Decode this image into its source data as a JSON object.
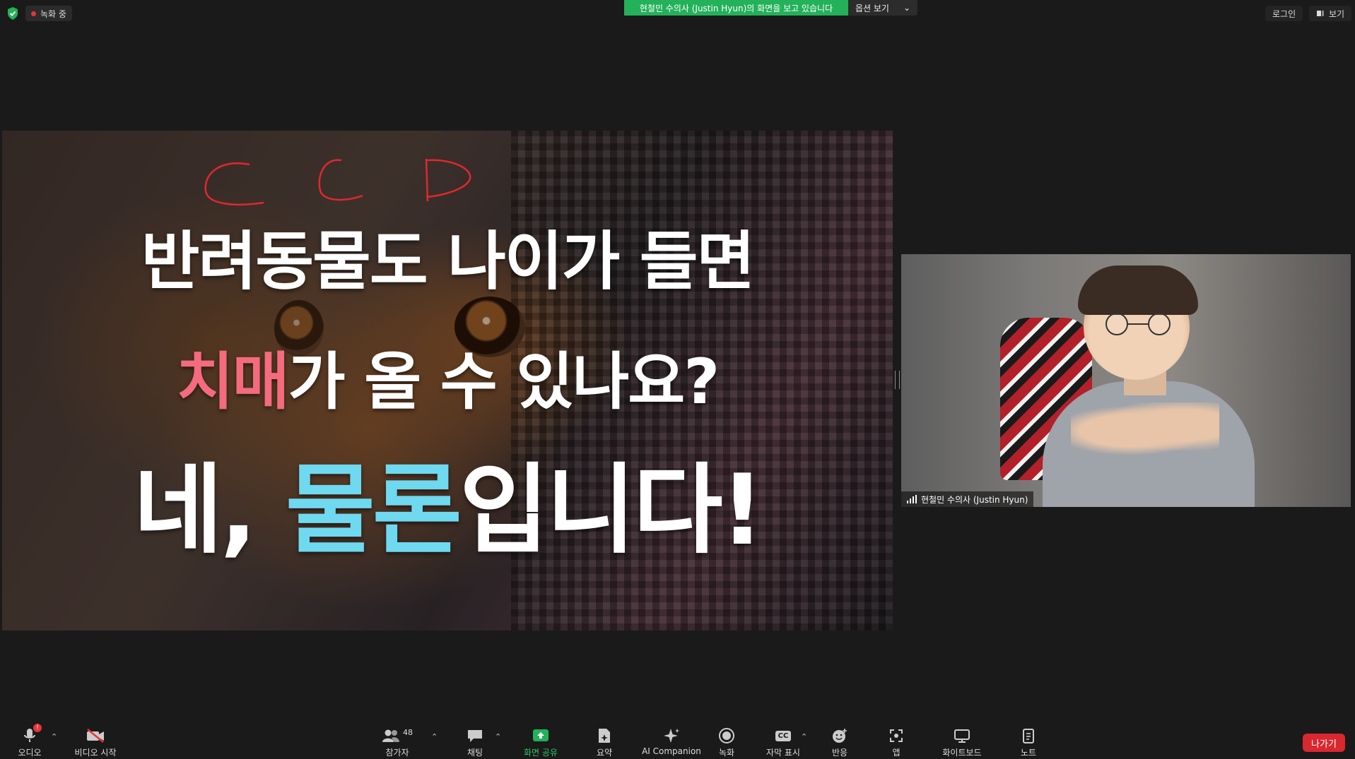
{
  "topbar": {
    "recording_label": "녹화 중",
    "share_banner": "현철민 수의사 (Justin  Hyun)의 화면을 보고 있습니다",
    "view_options": "옵션 보기",
    "login": "로그인",
    "view": "보기"
  },
  "slide": {
    "line1": "반려동물도 나이가 들면",
    "line2_highlight": "치매",
    "line2_rest": "가 올 수 있나요?",
    "line3_start": "네, ",
    "line3_highlight": "물론",
    "line3_end": "입니다!",
    "annotation_color": "#e0282e"
  },
  "video_tile": {
    "participant_name": "현철민 수의사 (Justin Hyun)"
  },
  "toolbar": {
    "audio": "오디오",
    "video": "비디오 시작",
    "participants": "참가자",
    "participant_count": "48",
    "chat": "채팅",
    "share": "화면 공유",
    "summary": "요약",
    "ai_companion": "AI Companion",
    "record": "녹화",
    "captions": "자막 표시",
    "captions_icon_text": "CC",
    "reactions": "반응",
    "apps": "앱",
    "whiteboard": "화이트보드",
    "notes": "노트",
    "leave": "나가기",
    "audio_badge": "!"
  },
  "colors": {
    "share_green": "#23b15a",
    "leave_red": "#d9282f",
    "highlight_pink": "#f46b7e",
    "highlight_cyan": "#6fd9f0"
  }
}
